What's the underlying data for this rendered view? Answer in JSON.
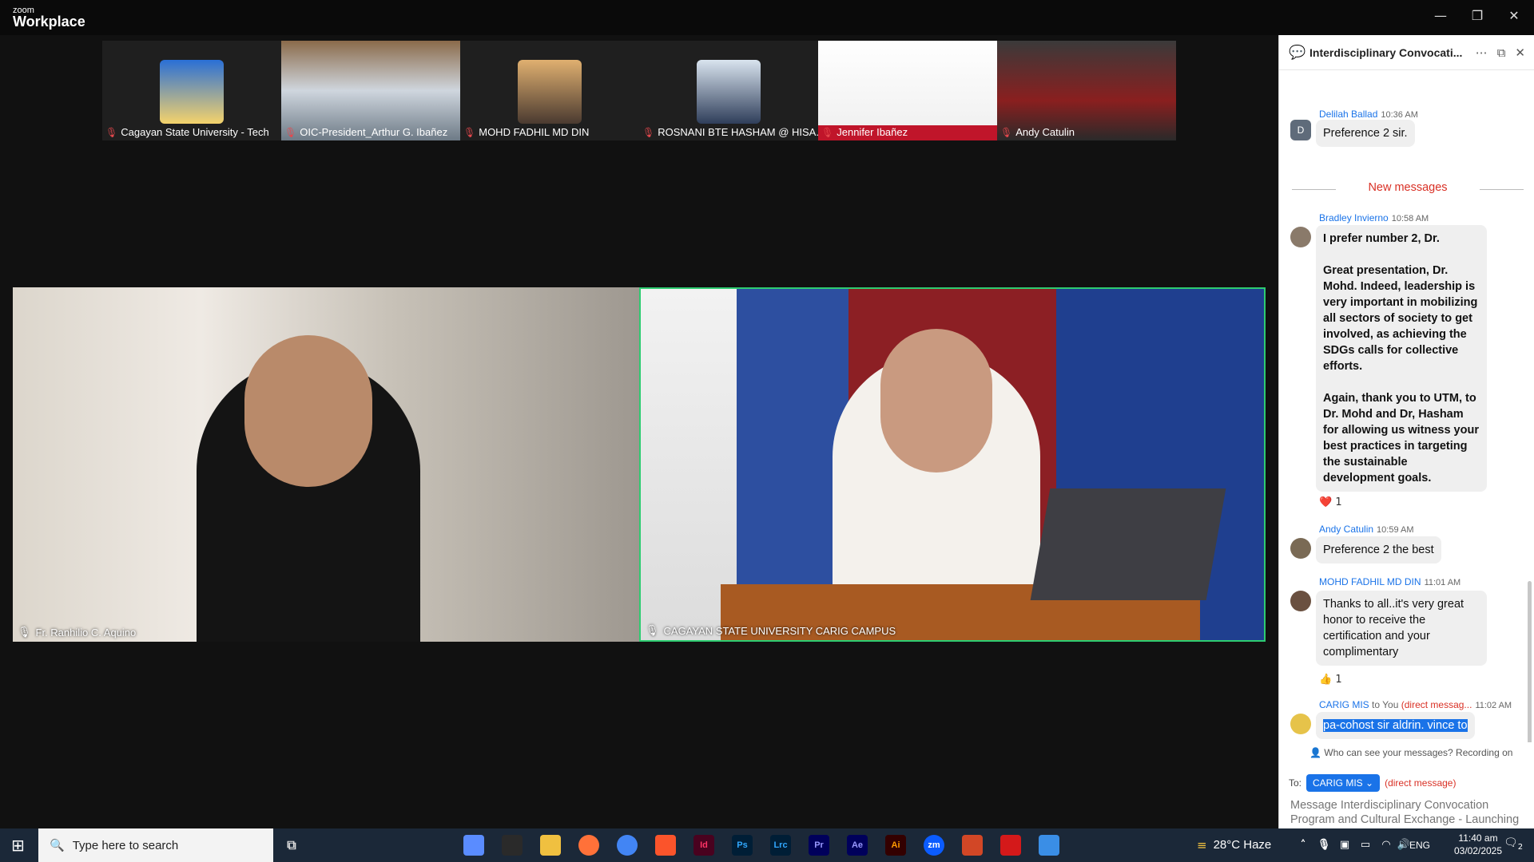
{
  "app": {
    "logo_small": "zoom",
    "logo_big": "Workplace"
  },
  "window_controls": {
    "minimize": "—",
    "restore": "❐",
    "close": "✕"
  },
  "participants_strip": [
    {
      "name": "Cagayan State University - Tech",
      "muted": true
    },
    {
      "name": "OIC-President_Arthur G. Ibañez",
      "muted": true
    },
    {
      "name": "MOHD FADHIL MD DIN",
      "muted": true
    },
    {
      "name": "ROSNANI BTE HASHAM @ HISA...",
      "muted": true
    },
    {
      "name": "Jennifer Ibañez",
      "muted": true
    },
    {
      "name": "Andy Catulin",
      "muted": true
    }
  ],
  "strip_next_icon": "chevron-right-icon",
  "main_videos": {
    "left": {
      "name": "Fr. Ranhilio C. Aquino"
    },
    "right": {
      "name": "CAGAYAN STATE UNIVERSITY CARIG CAMPUS"
    }
  },
  "chat": {
    "title": "Interdisciplinary Convocati...",
    "new_messages_label": "New messages",
    "messages": [
      {
        "sender": "Delilah Ballad",
        "time": "10:36 AM",
        "avatar_letter": "D",
        "text": "Preference 2 sir."
      },
      {
        "sender": "Bradley Invierno",
        "time": "10:58 AM",
        "paragraphs": [
          "I prefer number 2, Dr.",
          "Great presentation, Dr. Mohd. Indeed, leadership is very important in mobilizing all sectors of society to get involved, as achieving the SDGs calls for collective efforts.",
          "Again, thank you to UTM, to Dr. Mohd and Dr, Hasham for allowing us witness your best practices in targeting the sustainable development goals."
        ],
        "reaction": "❤️ 1"
      },
      {
        "sender": "Andy Catulin",
        "time": "10:59 AM",
        "text": "Preference 2 the best"
      },
      {
        "sender": "MOHD FADHIL MD DIN",
        "time": "11:01 AM",
        "text": "Thanks to all..it's very great honor to receive the certification and your complimentary",
        "reaction": "👍 1"
      },
      {
        "sender": "CARIG MIS",
        "to": "to You",
        "dm": "(direct messag...",
        "time": "11:02 AM",
        "text": "pa-cohost sir aldrin. vince to"
      }
    ],
    "who_can_see": "Who can see your messages? Recording on",
    "to_label": "To:",
    "to_value": "CARIG MIS",
    "direct_message_tag": "(direct message)",
    "input_placeholder": "Message Interdisciplinary Convocation Program and Cultural Exchange - Launching"
  },
  "taskbar": {
    "search_placeholder": "Type here to search",
    "weather": "28°C  Haze",
    "language": "ENG",
    "time": "11:40 am",
    "date": "03/02/2025",
    "notification_count": "2",
    "apps": [
      "Id",
      "Ps",
      "Lrc",
      "Pr",
      "Ae",
      "Ai",
      "zm"
    ]
  }
}
